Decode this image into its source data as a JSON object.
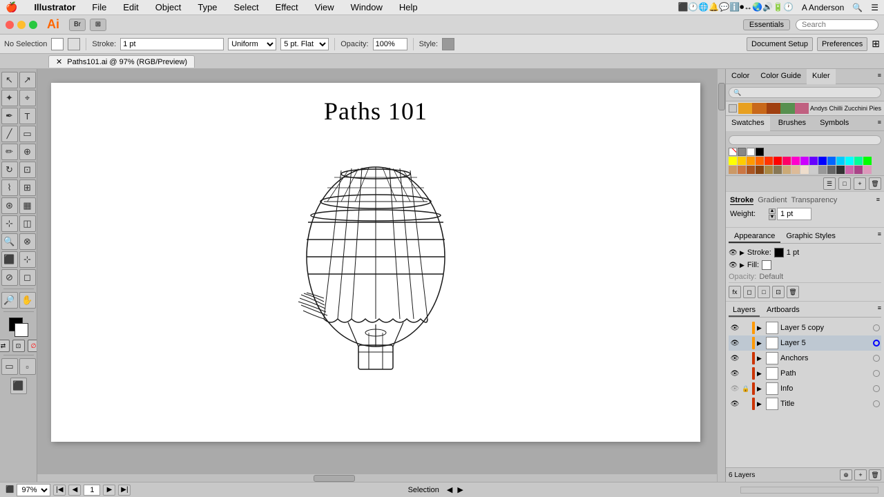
{
  "menubar": {
    "apple": "🍎",
    "app_name": "Illustrator",
    "menus": [
      "File",
      "Edit",
      "Object",
      "Type",
      "Select",
      "Effect",
      "View",
      "Window",
      "Help"
    ],
    "right_items": [
      "A Anderson"
    ],
    "icons": [
      "monitor-icon",
      "clock-icon",
      "wifi-icon",
      "bell-icon",
      "chat-icon",
      "info-icon",
      "record-icon",
      "arrows-icon",
      "lang-icon",
      "speaker-icon",
      "battery-icon",
      "time-icon"
    ]
  },
  "titlebar": {
    "ai_logo": "Ai",
    "bridge_btn": "Br",
    "arrange_btn": "⊞",
    "essentials": "Essentials",
    "search_placeholder": "Search"
  },
  "controlbar": {
    "selection_label": "No Selection",
    "stroke_label": "Stroke:",
    "stroke_value": "1 pt",
    "stroke_type": "Uniform",
    "stroke_cap": "5 pt. Flat",
    "opacity_label": "Opacity:",
    "opacity_value": "100%",
    "style_label": "Style:",
    "doc_setup_btn": "Document Setup",
    "preferences_btn": "Preferences"
  },
  "tabbar": {
    "tab_name": "Paths101.ai @ 97% (RGB/Preview)"
  },
  "canvas": {
    "title": "Paths 101"
  },
  "right_panel": {
    "color_tabs": [
      "Color",
      "Color Guide",
      "Kuler"
    ],
    "active_color_tab": "Kuler",
    "swatch_name": "Andys  Chilli Zucchini Pies",
    "swatches_tabs": [
      "Swatches",
      "Brushes",
      "Symbols"
    ],
    "active_swatches_tab": "Swatches",
    "stroke_tabs": [
      "Stroke",
      "Gradient",
      "Transparency"
    ],
    "active_stroke_tab": "Stroke",
    "weight_label": "Weight:",
    "weight_value": "1 pt",
    "appearance_tabs": [
      "Appearance",
      "Graphic Styles"
    ],
    "active_appearance_tab": "Appearance",
    "stroke_row": {
      "label": "Stroke:",
      "value": "1 pt"
    },
    "fill_row": {
      "label": "Fill:"
    },
    "opacity_row": {
      "label": "Opacity:",
      "value": "Default"
    },
    "layers_tabs": [
      "Layers",
      "Artboards"
    ],
    "active_layers_tab": "Layers",
    "layers": [
      {
        "name": "Layer 5 copy",
        "color": "#ff9900",
        "visible": true,
        "locked": false,
        "expanded": false
      },
      {
        "name": "Layer 5",
        "color": "#ff9900",
        "visible": true,
        "locked": false,
        "expanded": false,
        "active": true
      },
      {
        "name": "Anchors",
        "color": "#cc0000",
        "visible": true,
        "locked": false,
        "expanded": false
      },
      {
        "name": "Path",
        "color": "#cc0000",
        "visible": true,
        "locked": false,
        "expanded": false
      },
      {
        "name": "Info",
        "color": "#cc0000",
        "visible": false,
        "locked": true,
        "expanded": false
      },
      {
        "name": "Title",
        "color": "#cc0000",
        "visible": true,
        "locked": false,
        "expanded": false
      }
    ],
    "layers_count": "6 Layers"
  },
  "statusbar": {
    "zoom_value": "97%",
    "page_label": "1",
    "selection_label": "Selection"
  },
  "tools": {
    "selection": "↖",
    "direct_select": "↗",
    "lasso": "⌖",
    "magic_wand": "✦",
    "pen": "✒",
    "type": "T",
    "line": "╱",
    "rect": "▭",
    "brush": "✏",
    "blob_brush": "⊕",
    "rotate": "↻",
    "scale": "⊡",
    "warp": "⌇",
    "free_transform": "⊞",
    "sym_spray": "⊛",
    "column_graph": "▦",
    "mesh": "⊞",
    "gradient": "◫",
    "eyedropper": "🔍",
    "blend": "⊗",
    "live_paint": "⬛",
    "perspective": "⊹",
    "slice": "⊘",
    "eraser": "◻",
    "zoom": "🔎",
    "hand": "✋"
  }
}
